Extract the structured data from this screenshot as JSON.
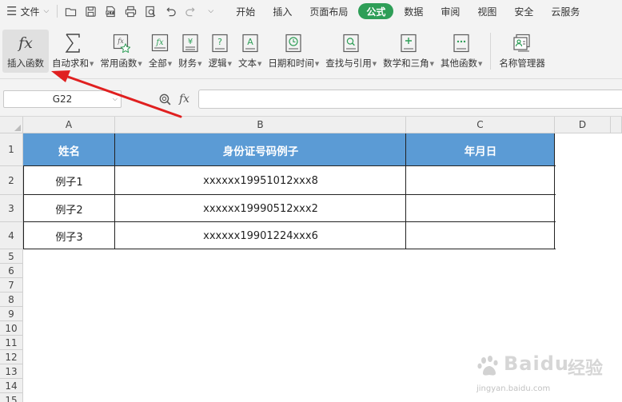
{
  "menubar": {
    "file_label": "文件",
    "quick_access_icons": [
      "open-folder-icon",
      "save-icon",
      "export-pdf-icon",
      "print-icon",
      "print-preview-icon",
      "undo-icon",
      "redo-icon",
      "customize-toolbar-icon"
    ],
    "tabs": [
      {
        "label": "开始",
        "active": false
      },
      {
        "label": "插入",
        "active": false
      },
      {
        "label": "页面布局",
        "active": false
      },
      {
        "label": "公式",
        "active": true
      },
      {
        "label": "数据",
        "active": false
      },
      {
        "label": "审阅",
        "active": false
      },
      {
        "label": "视图",
        "active": false
      },
      {
        "label": "安全",
        "active": false
      },
      {
        "label": "云服务",
        "active": false
      }
    ],
    "active_tab_color": "#2e9e57"
  },
  "ribbon": {
    "buttons": [
      {
        "label": "插入函数",
        "icon": "fx-icon",
        "dropdown": false,
        "active": true
      },
      {
        "label": "自动求和",
        "icon": "sigma-icon",
        "dropdown": true
      },
      {
        "label": "常用函数",
        "icon": "star-function-icon",
        "dropdown": true
      },
      {
        "label": "全部",
        "icon": "all-functions-icon",
        "dropdown": true
      },
      {
        "label": "财务",
        "icon": "finance-icon",
        "dropdown": true
      },
      {
        "label": "逻辑",
        "icon": "logic-icon",
        "dropdown": true
      },
      {
        "label": "文本",
        "icon": "text-function-icon",
        "dropdown": true
      },
      {
        "label": "日期和时间",
        "icon": "clock-icon",
        "dropdown": true
      },
      {
        "label": "查找与引用",
        "icon": "lookup-icon",
        "dropdown": true
      },
      {
        "label": "数学和三角",
        "icon": "math-icon",
        "dropdown": true
      },
      {
        "label": "其他函数",
        "icon": "more-functions-icon",
        "dropdown": true
      },
      {
        "label": "名称管理器",
        "icon": "name-manager-icon",
        "dropdown": false
      }
    ]
  },
  "formulabar": {
    "name_box": "G22",
    "fx_label": "fx",
    "formula_value": ""
  },
  "sheet": {
    "column_headers": [
      "A",
      "B",
      "C",
      "D"
    ],
    "row_headers": [
      "1",
      "2",
      "3",
      "4",
      "5",
      "6",
      "7",
      "8",
      "9",
      "10",
      "11",
      "12",
      "13",
      "14",
      "15"
    ],
    "header_row": [
      "姓名",
      "身份证号码例子",
      "年月日"
    ],
    "rows": [
      [
        "例子1",
        "xxxxxx19951012xxx8",
        ""
      ],
      [
        "例子2",
        "xxxxxx19990512xxx2",
        ""
      ],
      [
        "例子3",
        "xxxxxx19901224xxx6",
        ""
      ]
    ],
    "header_fill_color": "#5b9bd5"
  },
  "annotation": {
    "arrow_color": "#e02020"
  },
  "watermark": {
    "brand": "Baidu",
    "brand_cn": "经验",
    "url": "jingyan.baidu.com"
  }
}
